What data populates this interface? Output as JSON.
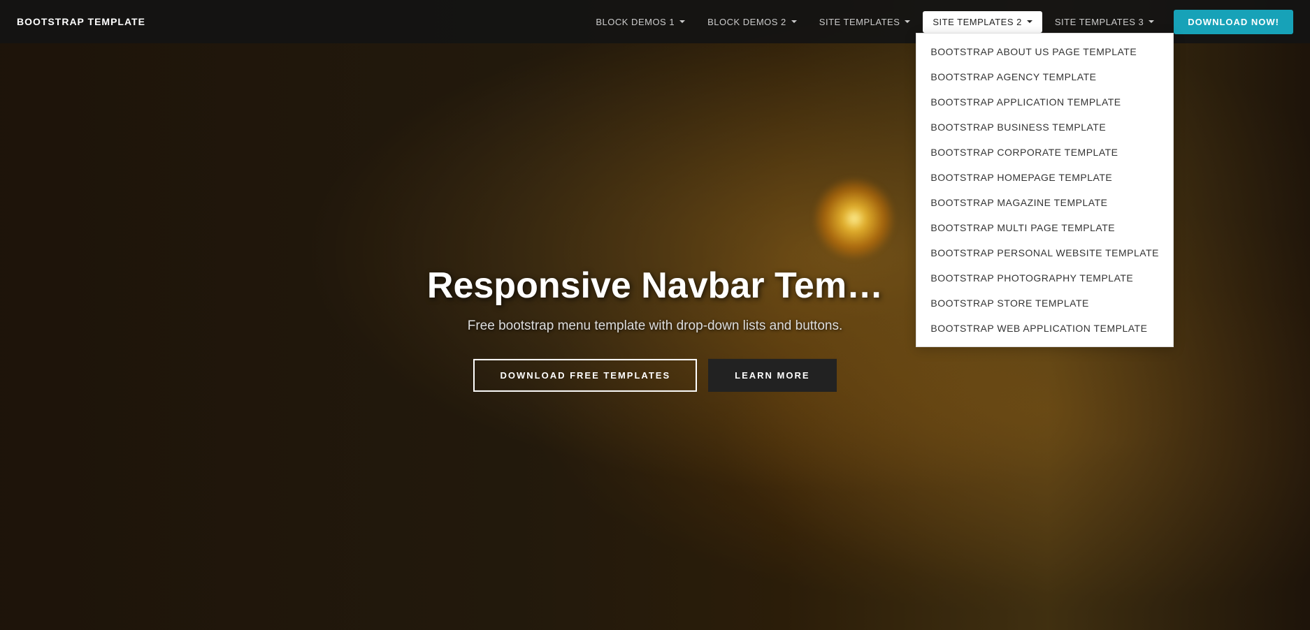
{
  "brand": {
    "label": "BOOTSTRAP TEMPLATE"
  },
  "nav": {
    "items": [
      {
        "id": "block-demos-1",
        "label": "BLOCK DEMOS 1",
        "hasDropdown": true
      },
      {
        "id": "block-demos-2",
        "label": "BLOCK DEMOS 2",
        "hasDropdown": true
      },
      {
        "id": "site-templates",
        "label": "SITE TEMPLATES",
        "hasDropdown": true
      },
      {
        "id": "site-templates-2",
        "label": "SITE TEMPLATES 2",
        "hasDropdown": true,
        "active": true
      },
      {
        "id": "site-templates-3",
        "label": "SITE TEMPLATES 3",
        "hasDropdown": true
      }
    ],
    "downloadButton": "DOWNLOAD NOW!"
  },
  "dropdown": {
    "site_templates_2": [
      "Bootstrap About Us Page Template",
      "Bootstrap Agency Template",
      "Bootstrap Application Template",
      "Bootstrap Business Template",
      "Bootstrap Corporate Template",
      "Bootstrap Homepage Template",
      "Bootstrap Magazine Template",
      "Bootstrap Multi Page Template",
      "Bootstrap Personal Website Template",
      "Bootstrap Photography Template",
      "Bootstrap Store Template",
      "Bootstrap Web Application Template"
    ]
  },
  "hero": {
    "title": "Responsive Navbar Tem...",
    "subtitle": "Free bootstrap menu template with drop-down lists and buttons.",
    "btn_primary": "DOWNLOAD FREE TEMPLATES",
    "btn_secondary": "LEARN MORE"
  },
  "colors": {
    "accent": "#17a2b8",
    "nav_active_bg": "#ffffff",
    "nav_active_text": "#222222"
  }
}
